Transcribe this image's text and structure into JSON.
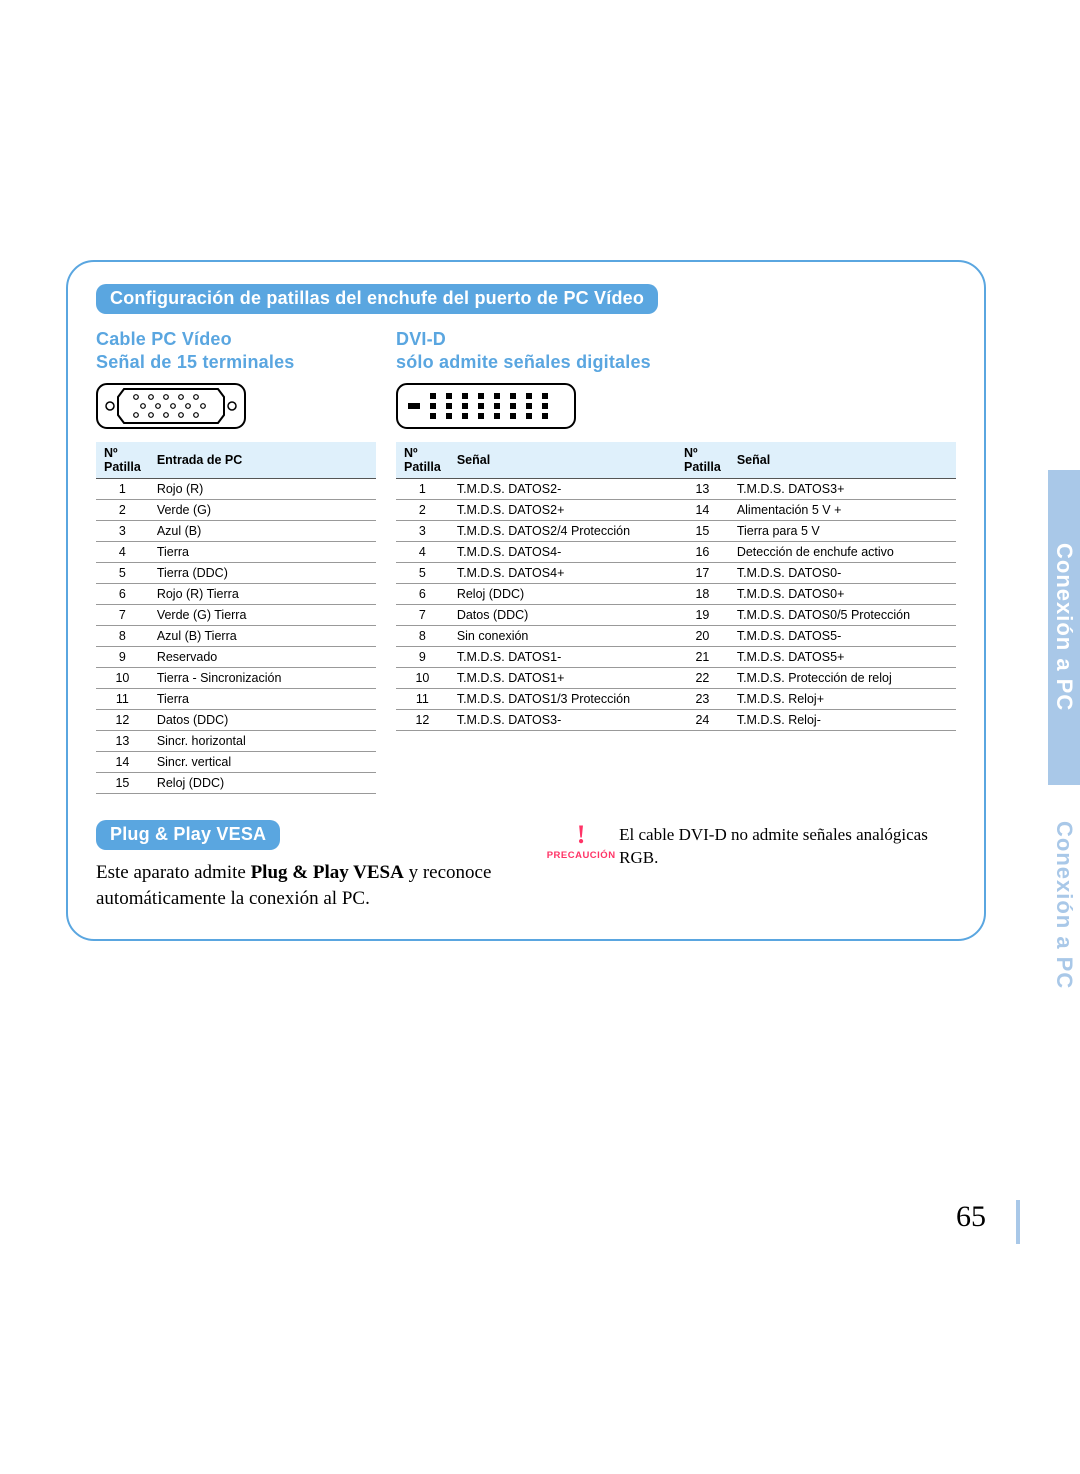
{
  "header_pill": "Configuración de patillas del enchufe del puerto de PC Vídeo",
  "vga": {
    "title1": "Cable PC Vídeo",
    "title2": "Señal de 15 terminales",
    "col_pin": "Nº Patilla",
    "col_sig": "Entrada de PC",
    "rows": [
      {
        "n": "1",
        "s": "Rojo (R)"
      },
      {
        "n": "2",
        "s": "Verde (G)"
      },
      {
        "n": "3",
        "s": "Azul (B)"
      },
      {
        "n": "4",
        "s": "Tierra"
      },
      {
        "n": "5",
        "s": "Tierra (DDC)"
      },
      {
        "n": "6",
        "s": "Rojo (R) Tierra"
      },
      {
        "n": "7",
        "s": "Verde (G) Tierra"
      },
      {
        "n": "8",
        "s": "Azul (B) Tierra"
      },
      {
        "n": "9",
        "s": "Reservado"
      },
      {
        "n": "10",
        "s": "Tierra - Sincronización"
      },
      {
        "n": "11",
        "s": "Tierra"
      },
      {
        "n": "12",
        "s": "Datos (DDC)"
      },
      {
        "n": "13",
        "s": "Sincr. horizontal"
      },
      {
        "n": "14",
        "s": "Sincr. vertical"
      },
      {
        "n": "15",
        "s": "Reloj (DDC)"
      }
    ]
  },
  "dvi": {
    "title1": "DVI-D",
    "title2": "sólo admite señales digitales",
    "col_pin": "Nº Patilla",
    "col_sig": "Señal",
    "col_pin2": "Nº Patilla",
    "col_sig2": "Señal",
    "rows_left": [
      {
        "n": "1",
        "s": "T.M.D.S. DATOS2-"
      },
      {
        "n": "2",
        "s": "T.M.D.S. DATOS2+"
      },
      {
        "n": "3",
        "s": "T.M.D.S. DATOS2/4 Protección"
      },
      {
        "n": "4",
        "s": "T.M.D.S. DATOS4-"
      },
      {
        "n": "5",
        "s": "T.M.D.S. DATOS4+"
      },
      {
        "n": "6",
        "s": "Reloj (DDC)"
      },
      {
        "n": "7",
        "s": "Datos (DDC)"
      },
      {
        "n": "8",
        "s": "Sin conexión"
      },
      {
        "n": "9",
        "s": "T.M.D.S. DATOS1-"
      },
      {
        "n": "10",
        "s": "T.M.D.S. DATOS1+"
      },
      {
        "n": "11",
        "s": "T.M.D.S. DATOS1/3 Protección"
      },
      {
        "n": "12",
        "s": "T.M.D.S. DATOS3-"
      }
    ],
    "rows_right": [
      {
        "n": "13",
        "s": "T.M.D.S. DATOS3+"
      },
      {
        "n": "14",
        "s": "Alimentación 5 V +"
      },
      {
        "n": "15",
        "s": "Tierra para 5 V"
      },
      {
        "n": "16",
        "s": "Detección de enchufe activo"
      },
      {
        "n": "17",
        "s": "T.M.D.S. DATOS0-"
      },
      {
        "n": "18",
        "s": "T.M.D.S. DATOS0+"
      },
      {
        "n": "19",
        "s": "T.M.D.S. DATOS0/5 Protección"
      },
      {
        "n": "20",
        "s": "T.M.D.S. DATOS5-"
      },
      {
        "n": "21",
        "s": "T.M.D.S. DATOS5+"
      },
      {
        "n": "22",
        "s": "T.M.D.S. Protección de reloj"
      },
      {
        "n": "23",
        "s": "T.M.D.S. Reloj+"
      },
      {
        "n": "24",
        "s": "T.M.D.S. Reloj-"
      }
    ]
  },
  "vesa": {
    "pill": "Plug & Play VESA",
    "text_1": "Este aparato admite ",
    "text_bold": "Plug & Play VESA",
    "text_2": " y reconoce automáticamente la conexión al PC."
  },
  "caution": {
    "bang": "!",
    "label": "PRECAUCIÓN",
    "text": "El cable DVI-D no admite señales analógicas RGB."
  },
  "side_tab": {
    "active": "Conexión a PC",
    "inactive": "Conexión a PC"
  },
  "page_number": "65"
}
